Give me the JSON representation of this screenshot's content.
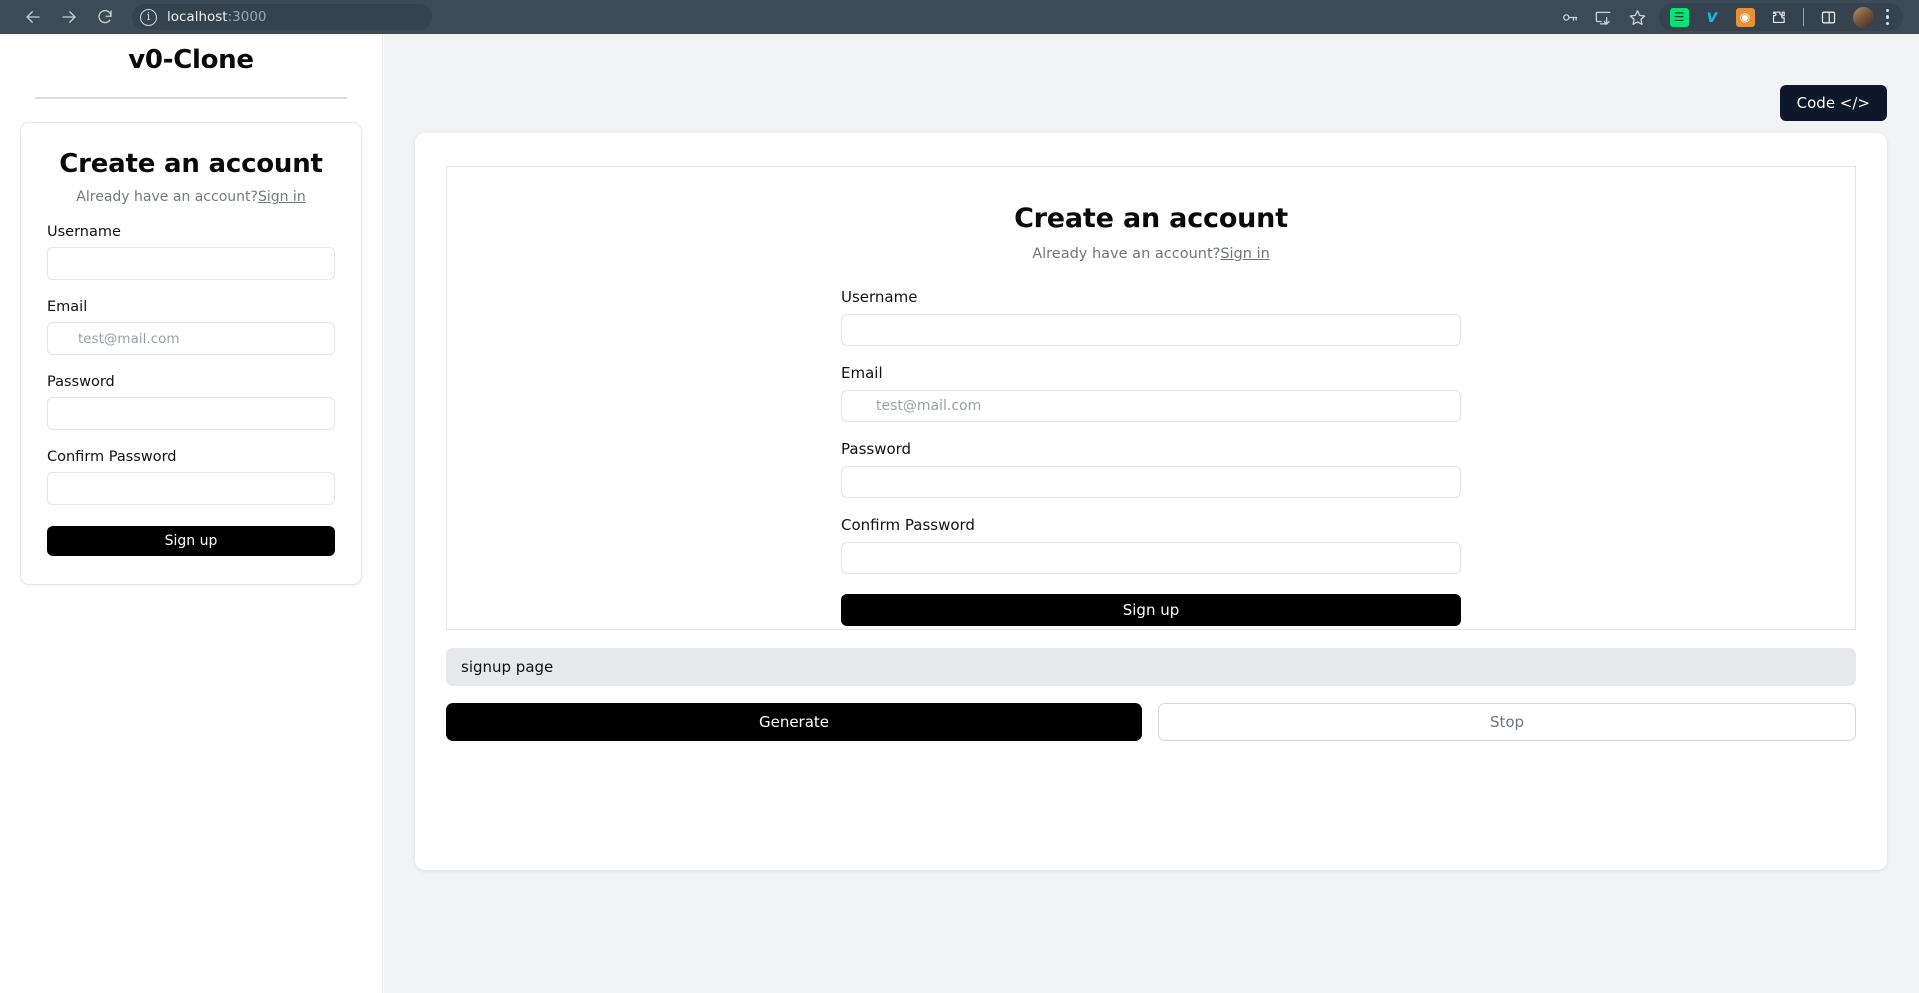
{
  "browser": {
    "back_icon": "arrow-left-icon",
    "forward_icon": "arrow-right-icon",
    "reload_icon": "reload-icon",
    "site_info_icon": "info-icon",
    "url_host": "localhost",
    "url_suffix": ":3000",
    "right_icons": [
      {
        "name": "password-key-icon",
        "glyph": "⚷"
      },
      {
        "name": "install-app-icon",
        "glyph": "⬇"
      },
      {
        "name": "bookmark-star-icon",
        "glyph": "☆"
      }
    ],
    "extensions": [
      {
        "name": "extension-green-icon",
        "color": "#00e676",
        "glyph": "≡"
      },
      {
        "name": "extension-vimeo-icon",
        "color": "#1ab7ea",
        "glyph": "v"
      },
      {
        "name": "extension-orange-icon",
        "color": "#e8903a",
        "glyph": "◎"
      },
      {
        "name": "extension-puzzle-icon",
        "color": "#ffffff",
        "glyph": "⬚"
      }
    ],
    "side_panel_icon": "side-panel-icon",
    "profile_icon": "profile-avatar",
    "menu_icon": "kebab-menu-icon"
  },
  "sidebar": {
    "brand": "v0-Clone",
    "form": {
      "title": "Create an account",
      "subtitle_text": "Already have an account?",
      "signin_link": "Sign in",
      "fields": [
        {
          "label": "Username",
          "value": "",
          "placeholder": "",
          "type": "text",
          "name": "username"
        },
        {
          "label": "Email",
          "value": "",
          "placeholder": "test@mail.com",
          "type": "email",
          "name": "email"
        },
        {
          "label": "Password",
          "value": "",
          "placeholder": "",
          "type": "password",
          "name": "password"
        },
        {
          "label": "Confirm Password",
          "value": "",
          "placeholder": "",
          "type": "password",
          "name": "confirm-password"
        }
      ],
      "submit_label": "Sign up"
    }
  },
  "main": {
    "code_button_label": "Code </>",
    "preview": {
      "title": "Create an account",
      "subtitle_text": "Already have an account?",
      "signin_link": "Sign in",
      "fields": [
        {
          "label": "Username",
          "value": "",
          "placeholder": "",
          "type": "text",
          "name": "username"
        },
        {
          "label": "Email",
          "value": "",
          "placeholder": "test@mail.com",
          "type": "email",
          "name": "email"
        },
        {
          "label": "Password",
          "value": "",
          "placeholder": "",
          "type": "password",
          "name": "password"
        },
        {
          "label": "Confirm Password",
          "value": "",
          "placeholder": "",
          "type": "password",
          "name": "confirm-password"
        }
      ],
      "submit_label": "Sign up"
    },
    "prompt": {
      "value": "signup page",
      "placeholder": "signup page"
    },
    "generate_label": "Generate",
    "stop_label": "Stop"
  },
  "colors": {
    "chrome_bg": "#3c4b55",
    "workspace_bg": "#f1f3f4",
    "code_button_bg": "#0f172a",
    "primary_button_bg": "#000000",
    "prompt_bg": "#e6e8ec"
  }
}
